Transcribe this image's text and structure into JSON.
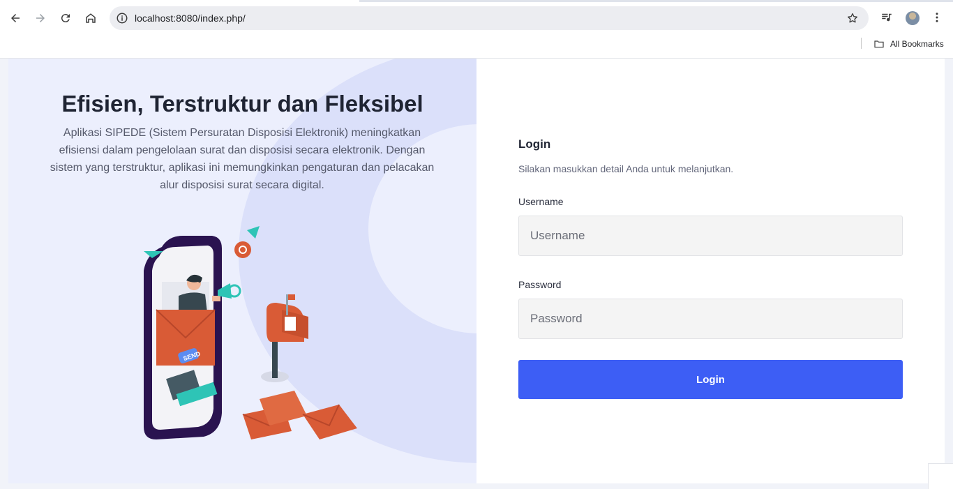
{
  "browser": {
    "url": "localhost:8080/index.php/",
    "bookmarks_label": "All Bookmarks"
  },
  "hero": {
    "title": "Efisien, Terstruktur dan Fleksibel",
    "description": "Aplikasi SIPEDE (Sistem Persuratan Disposisi Elektronik) meningkatkan efisiensi dalam pengelolaan surat dan disposisi secara elektronik. Dengan sistem yang terstruktur, aplikasi ini memungkinkan pengaturan dan pelacakan alur disposisi surat secara digital.",
    "illustration_badge": "SEND"
  },
  "login": {
    "title": "Login",
    "subtitle": "Silakan masukkan detail Anda untuk melanjutkan.",
    "username_label": "Username",
    "username_placeholder": "Username",
    "password_label": "Password",
    "password_placeholder": "Password",
    "submit_label": "Login"
  },
  "colors": {
    "primary": "#3d5ef5",
    "hero_bg": "#eceffd",
    "hero_blob": "#dbe0fa",
    "envelope": "#d95b36"
  }
}
